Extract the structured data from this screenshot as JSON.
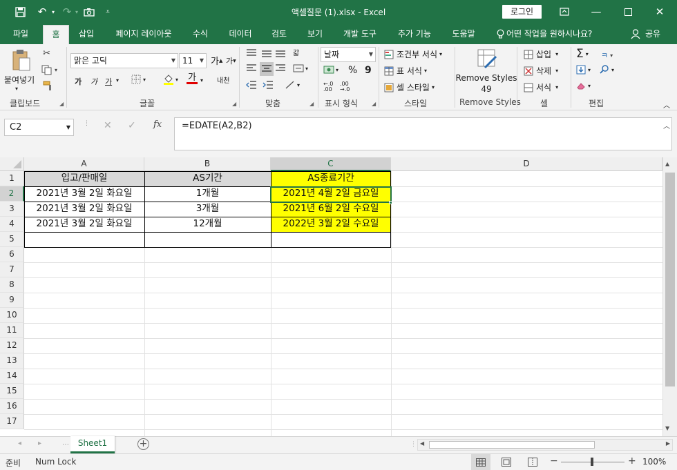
{
  "window": {
    "title": "액셀질문 (1).xlsx  -  Excel",
    "login_label": "로그인"
  },
  "tabs": [
    "파일",
    "홈",
    "삽입",
    "페이지 레이아웃",
    "수식",
    "데이터",
    "검토",
    "보기",
    "개발 도구",
    "추가 기능",
    "도움말"
  ],
  "tell_me": "어떤 작업을 원하시나요?",
  "share_label": "공유",
  "ribbon": {
    "clipboard": {
      "paste": "붙여넣기",
      "label": "클립보드"
    },
    "font": {
      "name": "맑은 고딕",
      "size": "11",
      "label": "글꼴",
      "bold": "가",
      "italic": "가",
      "underline": "가",
      "grow": "가",
      "shrink": "가",
      "color_letter": "가",
      "phonetic": "내천"
    },
    "alignment": {
      "label": "맞춤",
      "wrap": "갋"
    },
    "number": {
      "format": "날짜",
      "label": "표시 형식",
      "percent": "%",
      "comma": "9"
    },
    "styles": {
      "conditional": "조건부 서식",
      "table": "표 서식",
      "cell": "셀 스타일",
      "label": "스타일"
    },
    "remove_styles": {
      "line1": "Remove Styles",
      "line2": "49",
      "label": "Remove Styles"
    },
    "cells": {
      "insert": "삽입",
      "delete": "삭제",
      "format": "서식",
      "label": "셀"
    },
    "editing": {
      "label": "편집",
      "sort_glyph": "ㅋ"
    }
  },
  "formula_bar": {
    "name_box": "C2",
    "fx": "fx",
    "formula": "=EDATE(A2,B2)"
  },
  "columns": [
    "A",
    "B",
    "C",
    "D"
  ],
  "rows": [
    "1",
    "2",
    "3",
    "4",
    "5",
    "6",
    "7",
    "8",
    "9",
    "10",
    "11",
    "12",
    "13",
    "14",
    "15",
    "16",
    "17"
  ],
  "table": {
    "headers": [
      "입고/판매일",
      "AS기간",
      "AS종료기간"
    ],
    "rows": [
      [
        "2021년 3월 2일 화요일",
        "1개월",
        "2021년 4월 2일 금요일"
      ],
      [
        "2021년 3월 2일 화요일",
        "3개월",
        "2021년 6월 2일 수요일"
      ],
      [
        "2021년 3월 2일 화요일",
        "12개월",
        "2022년 3월 2일 수요일"
      ]
    ]
  },
  "sheets": [
    "Sheet1"
  ],
  "status": {
    "ready": "준비",
    "numlock": "Num Lock",
    "zoom": "100%"
  },
  "colors": {
    "excel_green": "#217346",
    "highlight_yellow": "#ffff00",
    "header_gray": "#d9d9d9"
  }
}
